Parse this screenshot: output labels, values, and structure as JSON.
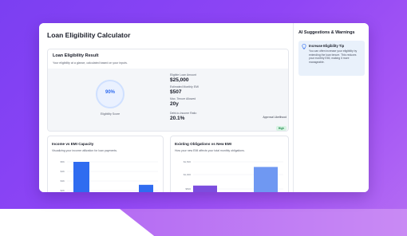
{
  "app": {
    "title": "Loan Eligibility Calculator"
  },
  "result": {
    "title": "Loan Eligibility Result",
    "subtitle": "Your eligibility at a glance, calculated based on your inputs.",
    "score_value": "90%",
    "score_fraction": 0.9,
    "score_label": "Eligibility Score",
    "metrics": [
      {
        "label": "Eligible Loan Amount",
        "value": "$25,000"
      },
      {
        "label": "Estimated Monthly EMI",
        "value": "$507"
      },
      {
        "label": "Max. Tenure Allowed",
        "value": "20y"
      },
      {
        "label": "Debt-to-Income Ratio",
        "value": "20.1%"
      }
    ],
    "likelihood_label": "Approval Likelihood",
    "likelihood_badge": "High"
  },
  "charts": {
    "income": {
      "title": "Income vs EMI Capacity",
      "subtitle": "Visualizing your income utilization for loan payments."
    },
    "obligations": {
      "title": "Existing Obligations vs New EMI",
      "subtitle": "How your new EMI affects your total monthly obligations."
    }
  },
  "chart_data": [
    {
      "type": "bar",
      "title": "Income vs EMI Capacity",
      "y_ticks": [
        "$5K",
        "$4K",
        "$3K",
        "$2K"
      ],
      "ylim": [
        0,
        5000
      ],
      "values": [
        5000,
        2000
      ],
      "colors": [
        "#2f6cf0",
        "#2f6cf0"
      ]
    },
    {
      "type": "bar",
      "title": "Existing Obligations vs New EMI",
      "y_ticks": [
        "$1,500",
        "$1,000",
        "$500"
      ],
      "ylim": [
        0,
        1500
      ],
      "values": [
        570,
        1300
      ],
      "colors": [
        "#7c4dde",
        "#6f98f2"
      ]
    }
  ],
  "sidebar": {
    "title": "AI Suggestions & Warnings",
    "tip": {
      "icon": "lightbulb-icon",
      "title": "Increase Eligibility Tip",
      "body": "You can often increase your eligibility by extending the loan tenure. This reduces your monthly EMI, making it more manageable."
    }
  }
}
